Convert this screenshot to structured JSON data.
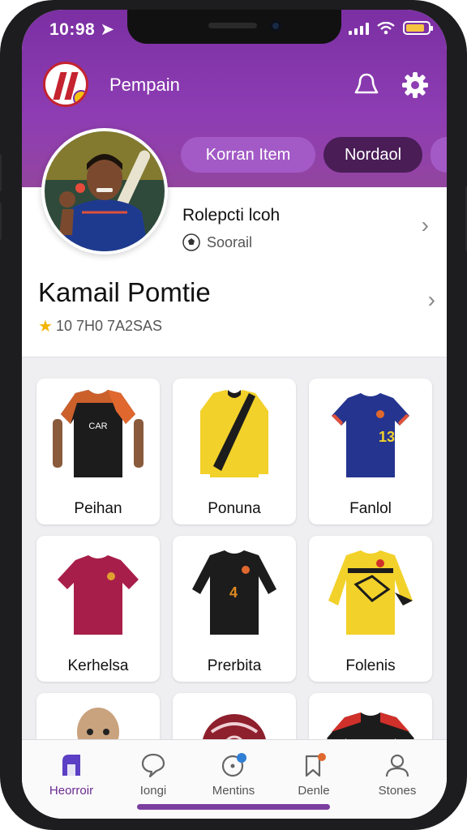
{
  "status": {
    "time": "10:98",
    "battery_level": 0.85
  },
  "header": {
    "app_title": "Pempain",
    "icons": [
      "team-logo",
      "profile-icon",
      "settings-icon"
    ],
    "pills": [
      {
        "label": "Korran Item"
      },
      {
        "label": "Nordaol"
      },
      {
        "label": ""
      }
    ]
  },
  "profile": {
    "subtitle": "Rolepcti lcoh",
    "sport": "Soorail",
    "name": "Kamail Pomtie",
    "rating_text": "10 7H0 7A2SAS"
  },
  "items": [
    {
      "label": "Peihan",
      "icon": "jersey-black-orange"
    },
    {
      "label": "Ponuna",
      "icon": "jersey-yellow-sash"
    },
    {
      "label": "Fanlol",
      "icon": "jersey-blue-13"
    },
    {
      "label": "Kerhelsa",
      "icon": "jersey-maroon"
    },
    {
      "label": "Prerbita",
      "icon": "jersey-black-4"
    },
    {
      "label": "Folenis",
      "icon": "jersey-yellow-pattern"
    },
    {
      "label": "",
      "icon": "mascot-figure"
    },
    {
      "label": "",
      "icon": "ball"
    },
    {
      "label": "",
      "icon": "jersey-red-black"
    }
  ],
  "tabs": [
    {
      "label": "Heorroir",
      "icon": "home-icon",
      "active": true
    },
    {
      "label": "Iongi",
      "icon": "chat-icon",
      "active": false
    },
    {
      "label": "Mentins",
      "icon": "notification-icon",
      "active": false
    },
    {
      "label": "Denle",
      "icon": "bookmark-icon",
      "active": false
    },
    {
      "label": "Stones",
      "icon": "user-icon",
      "active": false
    }
  ],
  "colors": {
    "header": "#8e3db3",
    "pill_light": "#a35ac6",
    "pill_dark": "#4a1d57",
    "accent": "#6b2b8e",
    "star": "#f3b400"
  }
}
